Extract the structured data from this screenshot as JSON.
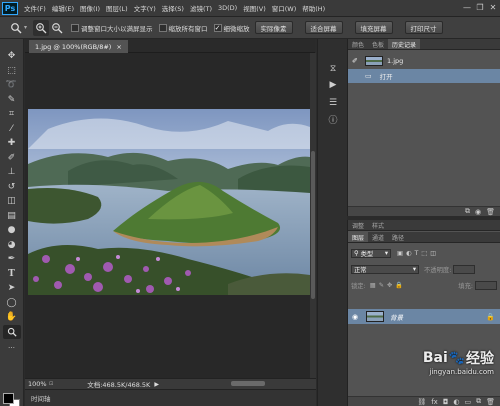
{
  "app": {
    "logo": "Ps"
  },
  "menu": [
    "文件(F)",
    "编辑(E)",
    "图像(I)",
    "图层(L)",
    "文字(Y)",
    "选择(S)",
    "滤镜(T)",
    "3D(D)",
    "视图(V)",
    "窗口(W)",
    "帮助(H)"
  ],
  "window_controls": {
    "minimize": "—",
    "restore": "❐",
    "close": "✕"
  },
  "options": {
    "tool_icon": "zoom-tool-icon",
    "checks": [
      {
        "label": "调整窗口大小以满屏显示",
        "checked": false
      },
      {
        "label": "缩放所有窗口",
        "checked": false
      },
      {
        "label": "细微缩放",
        "checked": true
      }
    ],
    "buttons": [
      "实际像素",
      "适合屏幕",
      "填充屏幕",
      "打印尺寸"
    ]
  },
  "tools": [
    "move-tool-icon",
    "marquee-tool-icon",
    "lasso-tool-icon",
    "quick-select-tool-icon",
    "crop-tool-icon",
    "eyedropper-tool-icon",
    "healing-brush-icon",
    "brush-tool-icon",
    "clone-stamp-icon",
    "history-brush-icon",
    "eraser-tool-icon",
    "gradient-tool-icon",
    "blur-tool-icon",
    "dodge-tool-icon",
    "pen-tool-icon",
    "type-tool-icon",
    "path-select-icon",
    "shape-tool-icon",
    "hand-tool-icon",
    "zoom-tool-icon"
  ],
  "document": {
    "tab_label": "1.jpg @ 100%(RGB/8#)",
    "tab_close": "×",
    "zoom": "100%",
    "doc_info": "文档:468.5K/468.5K",
    "status_arrow": "▶"
  },
  "timeline": {
    "label": "时间轴"
  },
  "history_panel": {
    "tabs": [
      "颜色",
      "色板",
      "历史记录"
    ],
    "active_tab": 2,
    "snapshot": "1.jpg",
    "states": [
      "打开"
    ]
  },
  "layers_panel": {
    "tabs_top": [
      "调整",
      "样式"
    ],
    "tabs": [
      "图层",
      "通道",
      "路径"
    ],
    "active_tab": 0,
    "filter_label": "类型",
    "blend_mode": "正常",
    "opacity_label": "不透明度:",
    "lock_label": "锁定:",
    "fill_label": "填充:",
    "layers": [
      {
        "name": "背景",
        "visible": true,
        "locked": true
      }
    ]
  },
  "watermark": {
    "brand": "Bai",
    "brand2": "经验",
    "url": "jingyan.baidu.com"
  }
}
